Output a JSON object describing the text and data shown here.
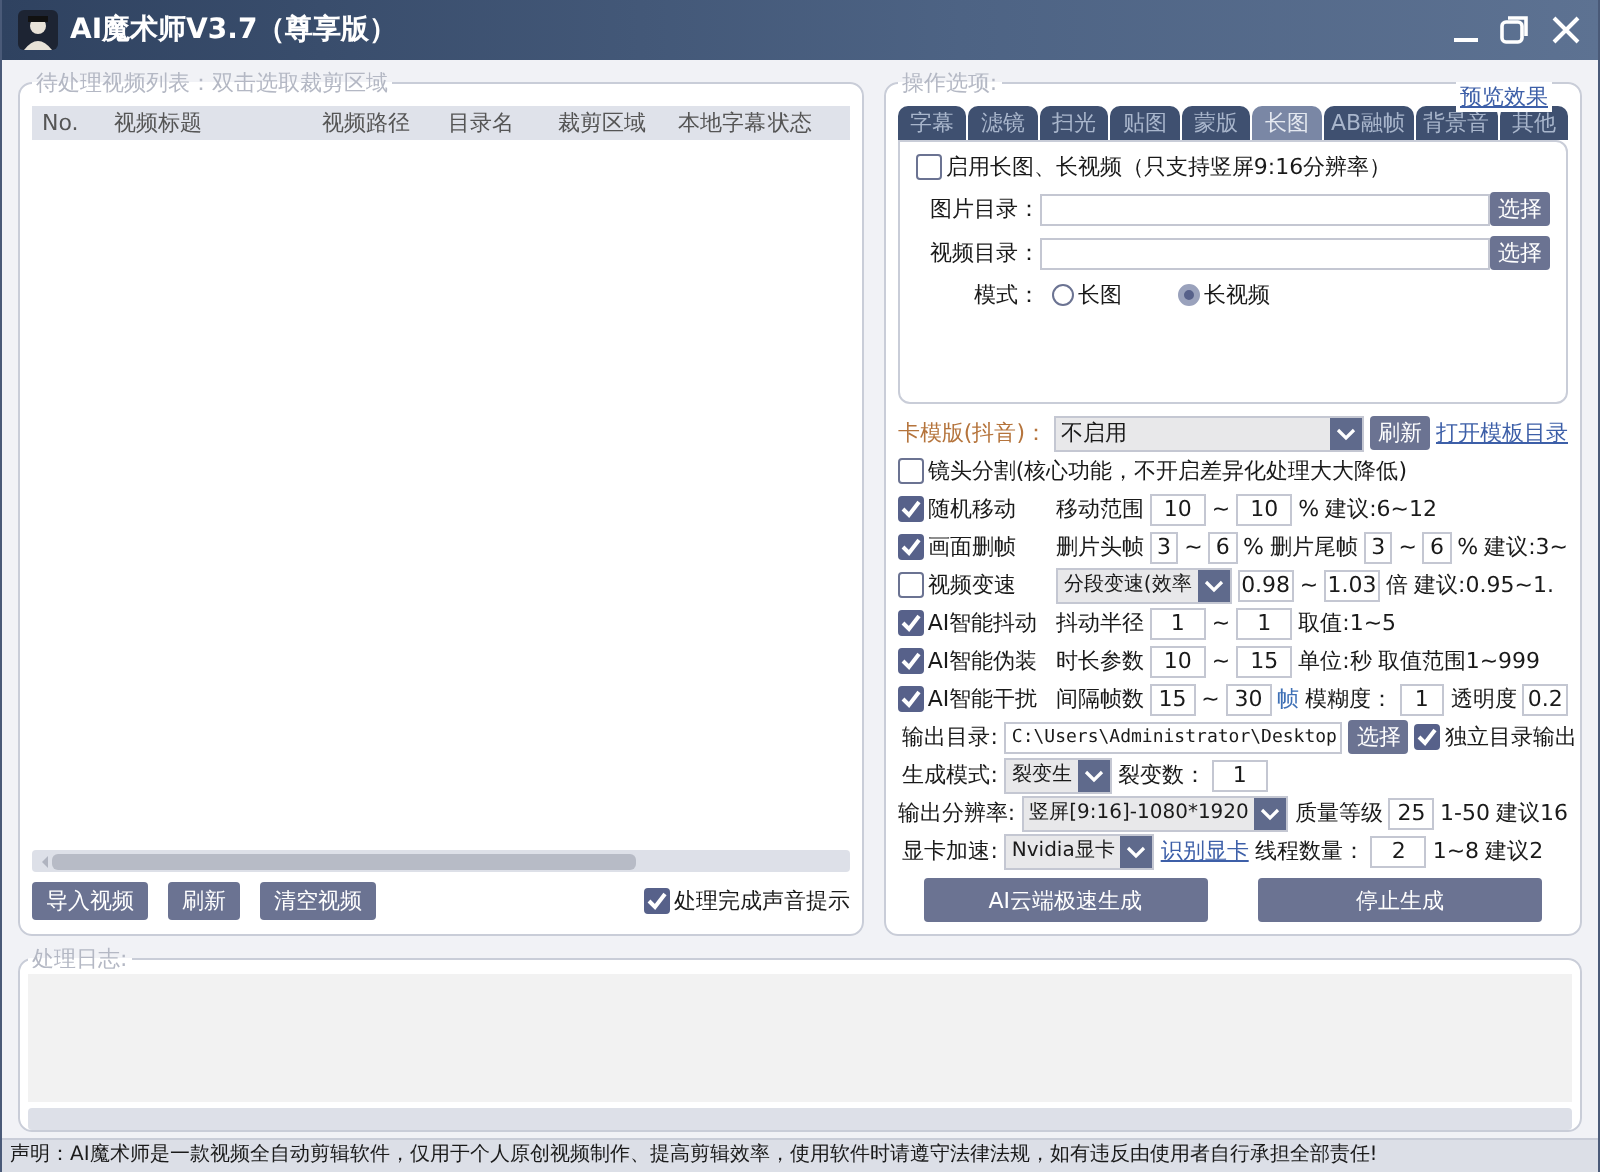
{
  "window": {
    "title": "AI魔术师V3.7（尊享版）"
  },
  "video_list": {
    "legend": "待处理视频列表：双击选取裁剪区域",
    "columns": [
      "No.",
      "视频标题",
      "视频路径",
      "目录名",
      "裁剪区域",
      "本地字幕",
      "状态"
    ],
    "buttons": [
      "导入视频",
      "刷新",
      "清空视频"
    ],
    "sound_notice": {
      "label": "处理完成声音提示",
      "checked": true
    }
  },
  "options": {
    "legend": "操作选项:",
    "preview_link": "预览效果",
    "tabs": [
      {
        "label": "字幕",
        "selected": false
      },
      {
        "label": "滤镜",
        "selected": false
      },
      {
        "label": "扫光",
        "selected": false
      },
      {
        "label": "贴图",
        "selected": false
      },
      {
        "label": "蒙版",
        "selected": false
      },
      {
        "label": "长图",
        "selected": true
      },
      {
        "label": "AB融帧",
        "selected": false
      },
      {
        "label": "背景音",
        "selected": false
      },
      {
        "label": "其他",
        "selected": false
      }
    ],
    "tab_rows": [
      {
        "parts": [
          {
            "kind": "checkbox",
            "label": "启用长图、长视频（只支持竖屏9:16分辨率）",
            "checked": false
          }
        ]
      },
      {
        "parts": [
          {
            "kind": "text",
            "text": "图片目录："
          },
          {
            "kind": "field"
          },
          {
            "kind": "button",
            "label": "选择"
          }
        ]
      },
      {
        "parts": [
          {
            "kind": "text",
            "text": "视频目录："
          },
          {
            "kind": "field"
          },
          {
            "kind": "button",
            "label": "选择"
          }
        ]
      },
      {
        "parts": [
          {
            "kind": "text",
            "text": "模式："
          },
          {
            "kind": "radio",
            "label": "长图",
            "selected": false
          },
          {
            "kind": "radio",
            "label": "长视频",
            "selected": true
          }
        ]
      }
    ],
    "rows": [
      {
        "parts": [
          {
            "kind": "text",
            "text": "卡模版(抖音)：",
            "color": "#b5743c"
          },
          {
            "kind": "select",
            "value": "不启用"
          },
          {
            "kind": "button",
            "label": "刷新"
          },
          {
            "kind": "link",
            "label": "打开模板目录"
          }
        ]
      },
      {
        "parts": [
          {
            "kind": "checkbox",
            "label": "镜头分割(核心功能，不开启差异化处理大大降低)",
            "checked": false
          }
        ]
      },
      {
        "parts": [
          {
            "kind": "checkbox",
            "label": "随机移动",
            "checked": true
          },
          {
            "kind": "text",
            "text": "移动范围"
          },
          {
            "kind": "input",
            "value": "10"
          },
          {
            "kind": "text",
            "text": "~"
          },
          {
            "kind": "input",
            "value": "10"
          },
          {
            "kind": "text",
            "text": "%"
          },
          {
            "kind": "text",
            "text": "建议:6~12"
          }
        ]
      },
      {
        "parts": [
          {
            "kind": "checkbox",
            "label": "画面删帧",
            "checked": true
          },
          {
            "kind": "text",
            "text": "删片头帧"
          },
          {
            "kind": "input",
            "value": "3"
          },
          {
            "kind": "text",
            "text": "~"
          },
          {
            "kind": "input",
            "value": "6"
          },
          {
            "kind": "text",
            "text": "%"
          },
          {
            "kind": "text",
            "text": "删片尾帧"
          },
          {
            "kind": "input",
            "value": "3"
          },
          {
            "kind": "text",
            "text": "~"
          },
          {
            "kind": "input",
            "value": "6"
          },
          {
            "kind": "text",
            "text": "%"
          },
          {
            "kind": "text",
            "text": "建议:3~"
          }
        ]
      },
      {
        "parts": [
          {
            "kind": "checkbox",
            "label": "视频变速",
            "checked": false
          },
          {
            "kind": "select",
            "value": "分段变速(效率"
          },
          {
            "kind": "input",
            "value": "0.98"
          },
          {
            "kind": "text",
            "text": "~"
          },
          {
            "kind": "input",
            "value": "1.03"
          },
          {
            "kind": "text",
            "text": "倍"
          },
          {
            "kind": "text",
            "text": "建议:0.95~1."
          }
        ]
      },
      {
        "parts": [
          {
            "kind": "checkbox",
            "label": "AI智能抖动",
            "checked": true
          },
          {
            "kind": "text",
            "text": "抖动半径"
          },
          {
            "kind": "input",
            "value": "1"
          },
          {
            "kind": "text",
            "text": "~"
          },
          {
            "kind": "input",
            "value": "1"
          },
          {
            "kind": "text",
            "text": "取值:1~5"
          }
        ]
      },
      {
        "parts": [
          {
            "kind": "checkbox",
            "label": "AI智能伪装",
            "checked": true
          },
          {
            "kind": "text",
            "text": "时长参数"
          },
          {
            "kind": "input",
            "value": "10"
          },
          {
            "kind": "text",
            "text": "~"
          },
          {
            "kind": "input",
            "value": "15"
          },
          {
            "kind": "text",
            "text": "单位:秒"
          },
          {
            "kind": "text",
            "text": "取值范围1~999"
          }
        ]
      },
      {
        "parts": [
          {
            "kind": "checkbox",
            "label": "AI智能干扰",
            "checked": true
          },
          {
            "kind": "text",
            "text": "间隔帧数"
          },
          {
            "kind": "input",
            "value": "15"
          },
          {
            "kind": "text",
            "text": "~"
          },
          {
            "kind": "input",
            "value": "30"
          },
          {
            "kind": "text",
            "text": "帧",
            "color": "#3d6fb5"
          },
          {
            "kind": "text",
            "text": "模糊度："
          },
          {
            "kind": "input",
            "value": "1"
          },
          {
            "kind": "text",
            "text": "透明度"
          },
          {
            "kind": "input",
            "value": "0.2"
          }
        ]
      },
      {
        "parts": [
          {
            "kind": "text",
            "text": "输出目录:"
          },
          {
            "kind": "field",
            "value": "C:\\Users\\Administrator\\Desktop"
          },
          {
            "kind": "button",
            "label": "选择"
          },
          {
            "kind": "checkbox",
            "label": "独立目录输出",
            "checked": true
          }
        ]
      },
      {
        "parts": [
          {
            "kind": "text",
            "text": "生成模式:"
          },
          {
            "kind": "select",
            "value": "裂变生"
          },
          {
            "kind": "text",
            "text": "裂变数："
          },
          {
            "kind": "input",
            "value": "1"
          }
        ]
      },
      {
        "parts": [
          {
            "kind": "text",
            "text": "输出分辨率:"
          },
          {
            "kind": "select",
            "value": "竖屏[9:16]-1080*1920"
          },
          {
            "kind": "text",
            "text": "质量等级"
          },
          {
            "kind": "input",
            "value": "25"
          },
          {
            "kind": "text",
            "text": "1-50"
          },
          {
            "kind": "text",
            "text": "建议16"
          }
        ]
      },
      {
        "parts": [
          {
            "kind": "text",
            "text": "显卡加速:"
          },
          {
            "kind": "select",
            "value": "Nvidia显卡"
          },
          {
            "kind": "link",
            "label": "识别显卡"
          },
          {
            "kind": "text",
            "text": "线程数量："
          },
          {
            "kind": "input",
            "value": "2"
          },
          {
            "kind": "text",
            "text": "1~8"
          },
          {
            "kind": "text",
            "text": "建议2"
          }
        ]
      }
    ],
    "actions": [
      "AI云端极速生成",
      "停止生成"
    ]
  },
  "log": {
    "legend": "处理日志:"
  },
  "status_bar": "声明：AI魔术师是一款视频全自动剪辑软件，仅用于个人原创视频制作、提高剪辑效率，使用软件时请遵守法律法规，如有违反由使用者自行承担全部责任!"
}
